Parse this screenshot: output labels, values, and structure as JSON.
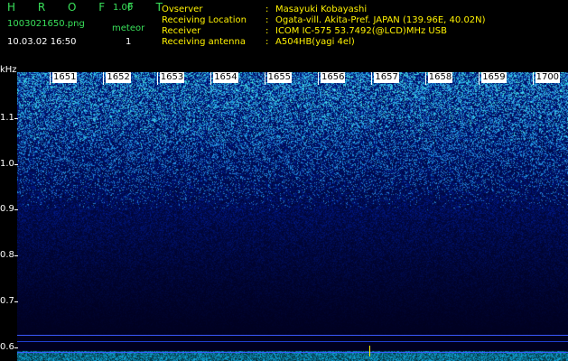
{
  "app": {
    "name": "HROFFT",
    "name_spaced": "H R O F F T",
    "version": "1.00"
  },
  "file": {
    "name": "1003021650.png",
    "datetime": "10.03.02 16:50"
  },
  "meteor": {
    "label": "meteor",
    "count": "1"
  },
  "meta": [
    {
      "label": "Ovserver",
      "value": "Masayuki Kobayashi"
    },
    {
      "label": "Receiving Location",
      "value": "Ogata-vill. Akita-Pref. JAPAN (139.96E, 40.02N)"
    },
    {
      "label": "Receiver",
      "value": "ICOM IC-575 53.7492(@LCD)MHz USB"
    },
    {
      "label": "Receiving antenna",
      "value": "A504HB(yagi 4el)"
    }
  ],
  "colors": {
    "accent_green": "#39e05a",
    "accent_yellow": "#fff200",
    "text_white": "#ffffff",
    "spectrum_dark": "#000033",
    "spectrum_blue": "#1a3ad6",
    "spectrum_cyan": "#39c8e6",
    "marker_yellow": "#fff200"
  },
  "axis": {
    "y_unit": "kHz",
    "y_ticks": [
      "1.1",
      "1.0",
      "0.9",
      "0.8",
      "0.7",
      "0.6"
    ],
    "x_ticks": [
      "1651",
      "1652",
      "1653",
      "1654",
      "1655",
      "1656",
      "1657",
      "1658",
      "1659",
      "1700"
    ]
  },
  "chart_data": {
    "type": "heatmap",
    "xlabel": "",
    "ylabel": "kHz",
    "y_unit": "kHz",
    "ylim": [
      0.57,
      1.2
    ],
    "x": [
      "1651",
      "1652",
      "1653",
      "1654",
      "1655",
      "1656",
      "1657",
      "1658",
      "1659",
      "1700"
    ],
    "y": [
      "1.1",
      "1.0",
      "0.9",
      "0.8",
      "0.7",
      "0.6"
    ],
    "intensity_by_band": [
      {
        "band": "1.1-1.2",
        "level": 0.85
      },
      {
        "band": "1.0-1.1",
        "level": 0.7
      },
      {
        "band": "0.9-1.0",
        "level": 0.55
      },
      {
        "band": "0.8-0.9",
        "level": 0.38
      },
      {
        "band": "0.7-0.8",
        "level": 0.22
      },
      {
        "band": "0.6-0.7",
        "level": 0.12
      }
    ],
    "meteor_markers": [
      {
        "time": "1657",
        "band": "0.6"
      }
    ],
    "grid": false
  }
}
